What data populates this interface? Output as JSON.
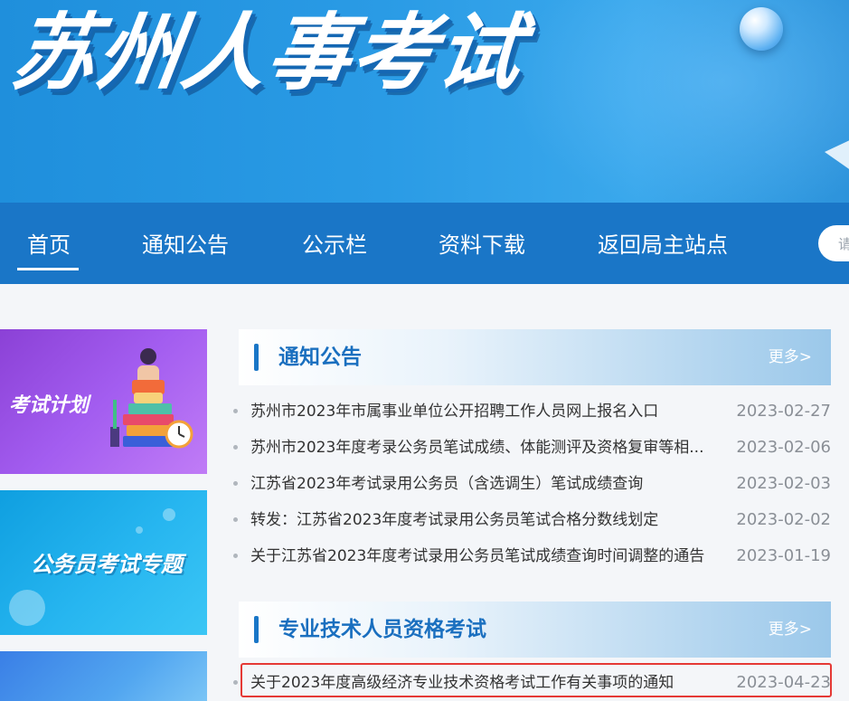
{
  "banner": {
    "title": "苏州人事考试"
  },
  "nav": {
    "items": [
      "首页",
      "通知公告",
      "公示栏",
      "资料下载",
      "返回局主站点"
    ],
    "active_index": 0,
    "search_placeholder": "请"
  },
  "promo_cards": [
    {
      "label": "考试计划"
    },
    {
      "label": "公务员考试专题"
    },
    {
      "label": ""
    }
  ],
  "notice_section": {
    "title": "通知公告",
    "more": "更多>",
    "items": [
      {
        "title": "苏州市2023年市属事业单位公开招聘工作人员网上报名入口",
        "date": "2023-02-27"
      },
      {
        "title": "苏州市2023年度考录公务员笔试成绩、体能测评及资格复审等相...",
        "date": "2023-02-06"
      },
      {
        "title": "江苏省2023年考试录用公务员（含选调生）笔试成绩查询",
        "date": "2023-02-03"
      },
      {
        "title": "转发：江苏省2023年度考试录用公务员笔试合格分数线划定",
        "date": "2023-02-02"
      },
      {
        "title": "关于江苏省2023年度考试录用公务员笔试成绩查询时间调整的通告",
        "date": "2023-01-19"
      }
    ]
  },
  "qualification_section": {
    "title": "专业技术人员资格考试",
    "more": "更多>",
    "items": [
      {
        "title": "关于2023年度高级经济专业技术资格考试工作有关事项的通知",
        "date": "2023-04-23",
        "highlighted": true
      }
    ]
  },
  "colors": {
    "nav_bg": "#1a76c7",
    "section_title": "#1a6fbf",
    "highlight_border": "#e53935"
  }
}
